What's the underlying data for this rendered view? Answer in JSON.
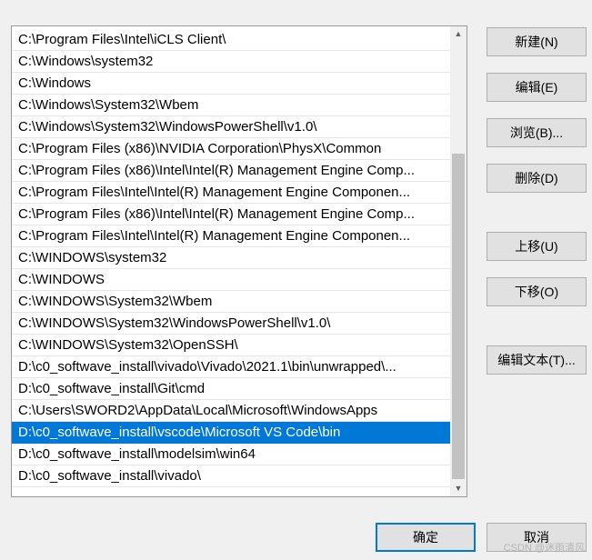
{
  "path_list": {
    "items": [
      "C:\\Program Files\\Intel\\iCLS Client\\",
      "C:\\Windows\\system32",
      "C:\\Windows",
      "C:\\Windows\\System32\\Wbem",
      "C:\\Windows\\System32\\WindowsPowerShell\\v1.0\\",
      "C:\\Program Files (x86)\\NVIDIA Corporation\\PhysX\\Common",
      "C:\\Program Files (x86)\\Intel\\Intel(R) Management Engine Comp...",
      "C:\\Program Files\\Intel\\Intel(R) Management Engine Componen...",
      "C:\\Program Files (x86)\\Intel\\Intel(R) Management Engine Comp...",
      "C:\\Program Files\\Intel\\Intel(R) Management Engine Componen...",
      "C:\\WINDOWS\\system32",
      "C:\\WINDOWS",
      "C:\\WINDOWS\\System32\\Wbem",
      "C:\\WINDOWS\\System32\\WindowsPowerShell\\v1.0\\",
      "C:\\WINDOWS\\System32\\OpenSSH\\",
      "D:\\c0_softwave_install\\vivado\\Vivado\\2021.1\\bin\\unwrapped\\...",
      "D:\\c0_softwave_install\\Git\\cmd",
      "C:\\Users\\SWORD2\\AppData\\Local\\Microsoft\\WindowsApps",
      "D:\\c0_softwave_install\\vscode\\Microsoft VS Code\\bin",
      "D:\\c0_softwave_install\\modelsim\\win64",
      "D:\\c0_softwave_install\\vivado\\"
    ],
    "selected_index": 18,
    "selected_color": "#0078d7"
  },
  "scrollbar": {
    "up_icon": "chevron-up-icon",
    "down_icon": "chevron-down-icon"
  },
  "buttons": {
    "new": "新建(N)",
    "edit": "编辑(E)",
    "browse": "浏览(B)...",
    "delete": "删除(D)",
    "move_up": "上移(U)",
    "move_down": "下移(O)",
    "edit_text": "编辑文本(T)...",
    "ok": "确定",
    "cancel": "取消"
  },
  "watermark": "CSDN @迷雨清风"
}
